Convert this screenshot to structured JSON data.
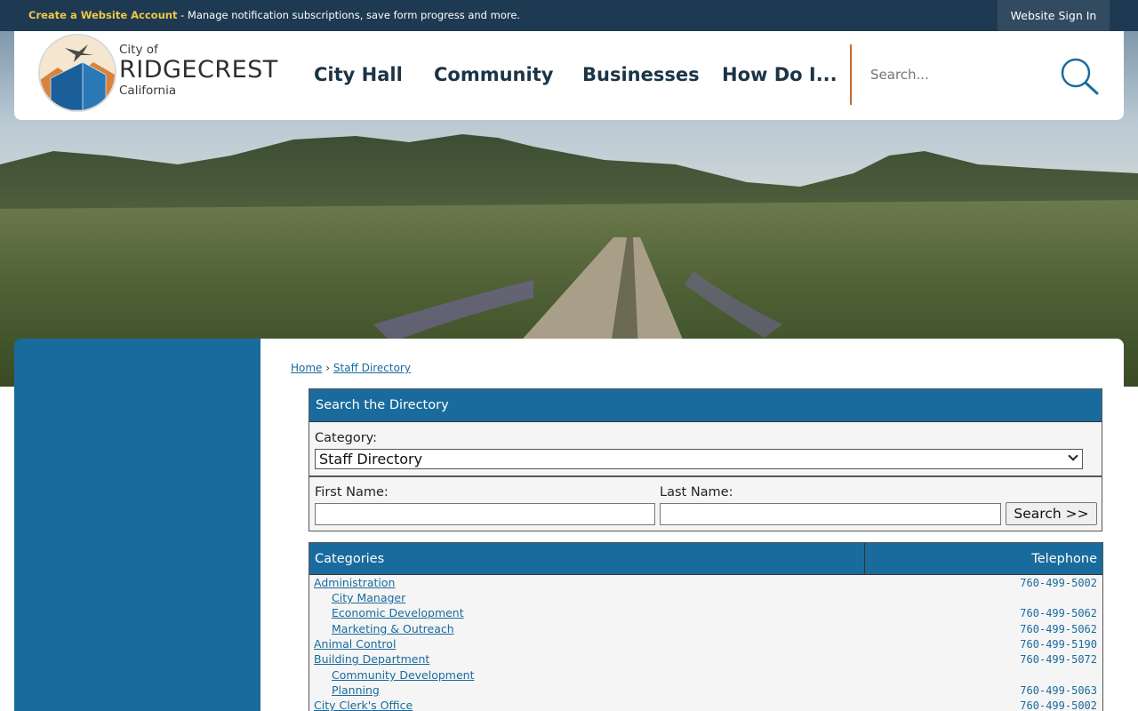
{
  "topbar": {
    "create_link": "Create a Website Account",
    "message": " - Manage notification subscriptions, save form progress and more.",
    "sign_in": "Website Sign In"
  },
  "header": {
    "logo": {
      "line1": "City of",
      "line2": "RIDGECREST",
      "line3": "California"
    },
    "nav": [
      "City Hall",
      "Community",
      "Businesses",
      "How Do I..."
    ],
    "search_placeholder": "Search..."
  },
  "breadcrumb": {
    "home": "Home",
    "separator": "›",
    "current": "Staff Directory"
  },
  "directory_search": {
    "title": "Search the Directory",
    "category_label": "Category:",
    "category_selected": "Staff Directory",
    "first_name_label": "First Name:",
    "last_name_label": "Last Name:",
    "search_button": "Search >>"
  },
  "table": {
    "headers": {
      "categories": "Categories",
      "telephone": "Telephone"
    },
    "rows": [
      {
        "name": "Administration",
        "indent": 0,
        "phone": "760-499-5002"
      },
      {
        "name": "City Manager",
        "indent": 1,
        "phone": ""
      },
      {
        "name": "Economic Development",
        "indent": 1,
        "phone": "760-499-5062"
      },
      {
        "name": "Marketing & Outreach",
        "indent": 1,
        "phone": "760-499-5062"
      },
      {
        "name": "Animal Control",
        "indent": 0,
        "phone": "760-499-5190"
      },
      {
        "name": "Building Department",
        "indent": 0,
        "phone": "760-499-5072"
      },
      {
        "name": "Community Development",
        "indent": 1,
        "phone": ""
      },
      {
        "name": "Planning",
        "indent": 1,
        "phone": "760-499-5063"
      },
      {
        "name": "City Clerk's Office",
        "indent": 0,
        "phone": "760-499-5002"
      }
    ]
  },
  "colors": {
    "topbar": "#1d3a52",
    "accent_yellow": "#f2c744",
    "brand_blue": "#1a6b9d",
    "nav_text": "#1b3446",
    "divider_orange": "#c9682a"
  }
}
